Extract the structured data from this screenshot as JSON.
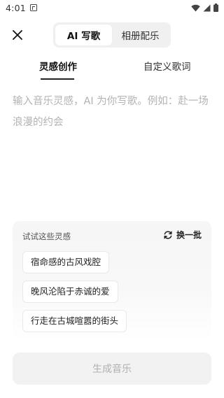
{
  "status_bar": {
    "time": "4:01"
  },
  "header": {
    "modes": [
      {
        "label": "AI 写歌",
        "active": true
      },
      {
        "label": "相册配乐",
        "active": false
      }
    ]
  },
  "sub_tabs": [
    {
      "label": "灵感创作",
      "active": true
    },
    {
      "label": "自定义歌词",
      "active": false
    }
  ],
  "prompt": {
    "value": "",
    "placeholder": "输入音乐灵感，AI 为你写歌。例如：赴一场浪漫的约会"
  },
  "inspiration": {
    "title": "试试这些灵感",
    "refresh_label": "换一批",
    "suggestions": [
      "宿命感的古风戏腔",
      "晚风沦陷于赤诚的爱",
      "行走在古城喧嚣的街头"
    ]
  },
  "generate_button": {
    "label": "生成音乐"
  },
  "icons": {
    "close": "close-icon",
    "refresh": "refresh-icon",
    "wifi": "wifi-icon",
    "signal": "signal-icon",
    "battery": "battery-icon",
    "notification": "notification-icon"
  }
}
